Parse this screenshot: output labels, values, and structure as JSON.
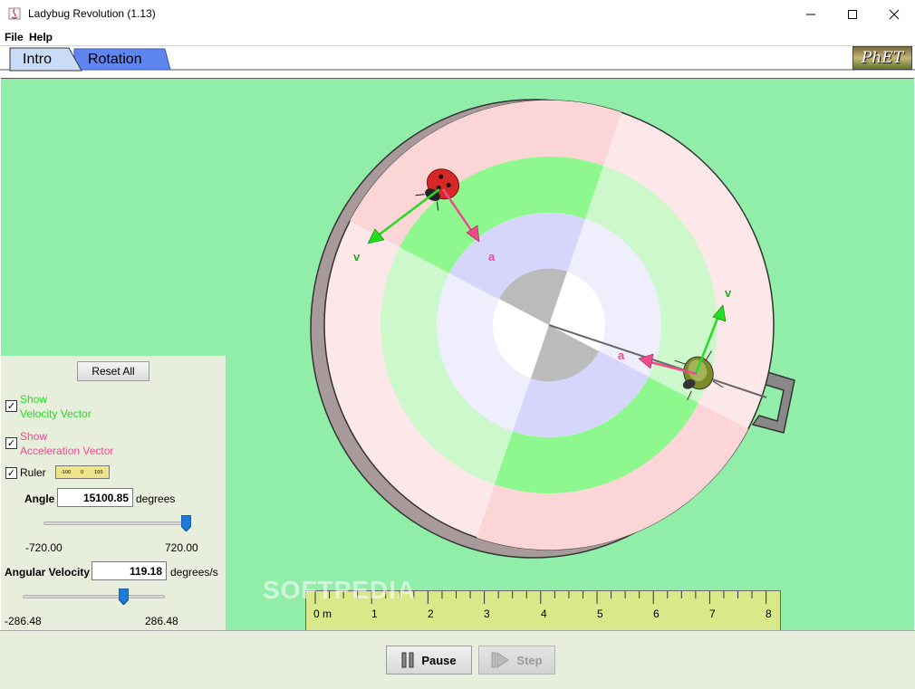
{
  "window": {
    "title": "Ladybug Revolution (1.13)"
  },
  "menu": {
    "file": "File",
    "help": "Help"
  },
  "tabs": [
    {
      "label": "Intro",
      "selected": true
    },
    {
      "label": "Rotation",
      "selected": false
    }
  ],
  "logo": "PhET",
  "simulation": {
    "velocity_label_bug1": "v",
    "acceleration_label_bug1": "a",
    "velocity_label_bug2": "v",
    "acceleration_label_bug2": "a",
    "colors": {
      "background": "#90eea8",
      "velocity": "#22dd22",
      "acceleration": "#ee4b8d"
    }
  },
  "controls": {
    "reset_all": "Reset All",
    "show_velocity": {
      "line1": "Show",
      "line2": "Velocity Vector",
      "checked": true
    },
    "show_acceleration": {
      "line1": "Show",
      "line2": "Acceleration Vector",
      "checked": true
    },
    "ruler": {
      "label": "Ruler",
      "checked": true,
      "ticks": [
        "-100",
        "0",
        "100"
      ]
    },
    "angle": {
      "label": "Angle",
      "value": "15100.85",
      "unit": "degrees",
      "min": "-720.00",
      "max": "720.00",
      "slider_fraction": 1.0
    },
    "angular_velocity": {
      "label": "Angular Velocity",
      "value": "119.18",
      "unit": "degrees/s",
      "min": "-286.48",
      "max": "286.48",
      "slider_fraction": 0.71
    }
  },
  "ruler": {
    "labels": [
      "0 m",
      "1",
      "2",
      "3",
      "4",
      "5",
      "6",
      "7",
      "8"
    ]
  },
  "playback": {
    "pause": "Pause",
    "step": "Step"
  },
  "watermark": "SOFTPEDIA"
}
